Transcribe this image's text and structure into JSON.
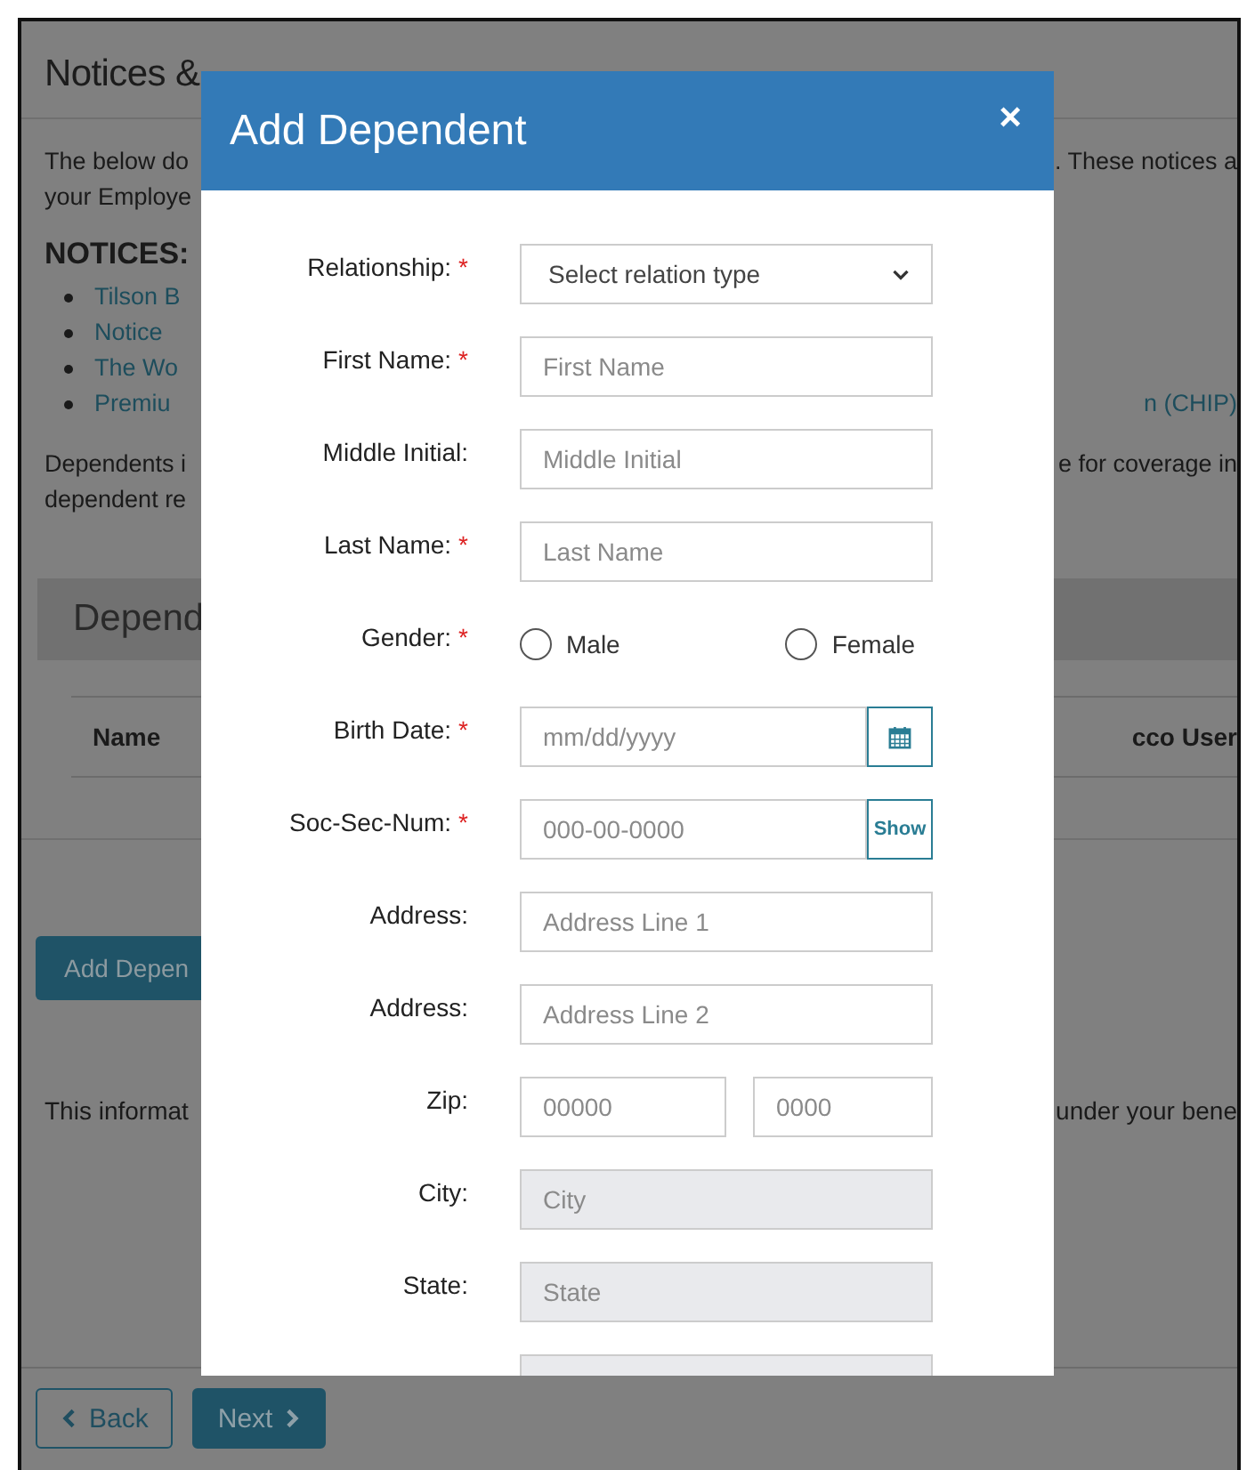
{
  "page": {
    "title": "Notices &",
    "intro": [
      {
        "left": "The below do",
        "right": ". These notices a"
      },
      {
        "left": "your Employe"
      }
    ],
    "notices_heading": "NOTICES:",
    "notices": [
      {
        "text": "Tilson B"
      },
      {
        "text": "Notice"
      },
      {
        "text": "The Wo"
      },
      {
        "text": "Premiu",
        "right": "n (CHIP)"
      }
    ],
    "dependents_text": [
      {
        "left": "Dependents i",
        "right": "e for coverage in"
      },
      {
        "left": "dependent re"
      }
    ],
    "section_title": "Depend",
    "table": {
      "columns": [
        "Name",
        "cco User"
      ]
    },
    "add_button": "Add Depen",
    "info": {
      "left": "This informat",
      "right": "under your bene"
    },
    "footer": {
      "back": "Back",
      "next": "Next"
    }
  },
  "modal": {
    "title": "Add Dependent",
    "close": "×",
    "fields": [
      {
        "kind": "select",
        "label": "Relationship:",
        "mark": "*",
        "placeholder": "Select relation type"
      },
      {
        "kind": "text",
        "label": "First Name:",
        "mark": "*",
        "placeholder": "First Name",
        "disabled": false
      },
      {
        "kind": "text",
        "label": "Middle Initial:",
        "placeholder": "Middle Initial",
        "disabled": false
      },
      {
        "kind": "text",
        "label": "Last Name:",
        "mark": "*",
        "placeholder": "Last Name",
        "disabled": false
      },
      {
        "kind": "radio",
        "label": "Gender:",
        "mark": "*",
        "options": [
          {
            "label": "Male",
            "selected": false
          },
          {
            "label": "Female",
            "selected": false
          }
        ]
      },
      {
        "kind": "date",
        "label": "Birth Date:",
        "mark": "*",
        "placeholder": "mm/dd/yyyy"
      },
      {
        "kind": "ssn",
        "label": "Soc-Sec-Num:",
        "mark": "*",
        "placeholder": "000-00-0000",
        "button": "Show"
      },
      {
        "kind": "text",
        "label": "Address:",
        "placeholder": "Address Line 1",
        "disabled": false
      },
      {
        "kind": "text",
        "label": "Address:",
        "placeholder": "Address Line 2",
        "disabled": false
      },
      {
        "kind": "zip",
        "label": "Zip:",
        "placeholders": [
          "00000",
          "0000"
        ]
      },
      {
        "kind": "text",
        "label": "City:",
        "placeholder": "City",
        "disabled": true
      },
      {
        "kind": "text",
        "label": "State:",
        "placeholder": "State",
        "disabled": true
      },
      {
        "kind": "cut"
      }
    ]
  }
}
